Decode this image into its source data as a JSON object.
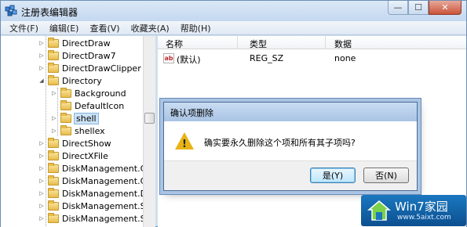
{
  "window": {
    "title": "注册表编辑器"
  },
  "menu": [
    "文件(F)",
    "编辑(E)",
    "查看(V)",
    "收藏夹(A)",
    "帮助(H)"
  ],
  "tree": [
    {
      "label": "DirectDraw",
      "level": 0,
      "state": "collapsed"
    },
    {
      "label": "DirectDraw7",
      "level": 0,
      "state": "collapsed"
    },
    {
      "label": "DirectDrawClipper",
      "level": 0,
      "state": "collapsed"
    },
    {
      "label": "Directory",
      "level": 0,
      "state": "expanded"
    },
    {
      "label": "Background",
      "level": 1,
      "state": "collapsed"
    },
    {
      "label": "DefaultIcon",
      "level": 1,
      "state": "leaf"
    },
    {
      "label": "shell",
      "level": 1,
      "state": "collapsed",
      "selected": true
    },
    {
      "label": "shellex",
      "level": 1,
      "state": "collapsed"
    },
    {
      "label": "DirectShow",
      "level": 0,
      "state": "collapsed"
    },
    {
      "label": "DirectXFile",
      "level": 0,
      "state": "collapsed"
    },
    {
      "label": "DiskManagement.Cor",
      "level": 0,
      "state": "collapsed"
    },
    {
      "label": "DiskManagement.Cor",
      "level": 0,
      "state": "collapsed"
    },
    {
      "label": "DiskManagement.Dat",
      "level": 0,
      "state": "collapsed"
    },
    {
      "label": "DiskManagement.Sna",
      "level": 0,
      "state": "collapsed"
    },
    {
      "label": "DiskManagement.Sna",
      "level": 0,
      "state": "collapsed"
    }
  ],
  "list": {
    "columns": [
      "名称",
      "类型",
      "数据"
    ],
    "rows": [
      {
        "name": "(默认)",
        "type": "REG_SZ",
        "data": "none",
        "icon": "string-value-icon"
      }
    ]
  },
  "dialog": {
    "title": "确认项删除",
    "message": "确实要永久删除这个项和所有其子项吗?",
    "yes_label": "是(Y)",
    "no_label": "否(N)",
    "icon": "warning-icon"
  },
  "watermark": {
    "title": "Win7家园",
    "url": "www.5aixt.com"
  }
}
